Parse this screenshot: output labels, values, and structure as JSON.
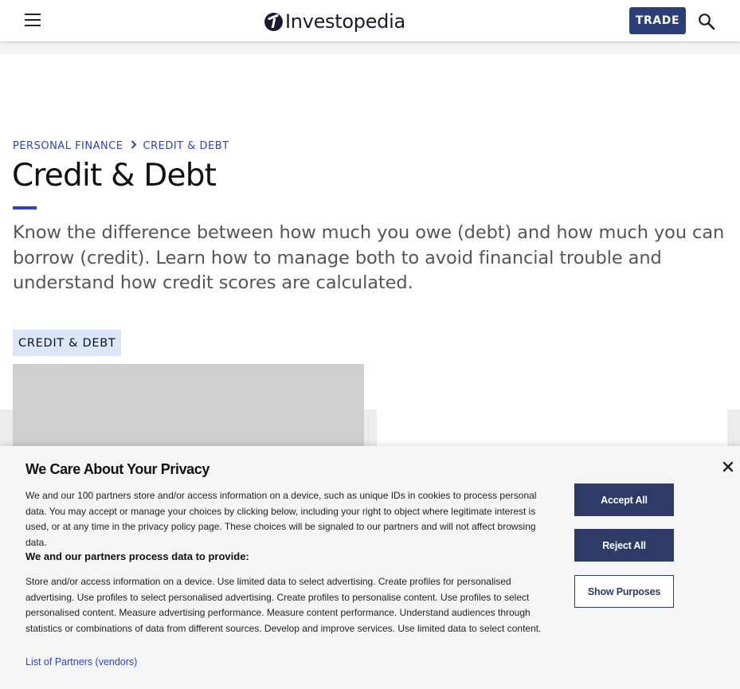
{
  "header": {
    "logo_text": "Investopedia",
    "trade_label": "TRADE",
    "icons": [
      "hamburger-menu-icon",
      "investopedia-logo-icon",
      "search-icon"
    ]
  },
  "breadcrumb": {
    "items": [
      "PERSONAL FINANCE",
      "CREDIT & DEBT"
    ],
    "separator_icon": "chevron-right-icon"
  },
  "page": {
    "title": "Credit & Debt",
    "intro": "Know the difference between how much you owe (debt) and how much you can borrow (credit). Learn how to manage both to avoid financial trouble and understand how credit scores are calculated.",
    "tag_label": "CREDIT & DEBT"
  },
  "privacy": {
    "title": "We Care About Your Privacy",
    "intro": "We and our 100 partners store and/or access information on a device, such as unique IDs in cookies to process personal data. You may accept or manage your choices by clicking below, including your right to object where legitimate interest is used, or at any time in the privacy policy page. These choices will be signaled to our partners and will not affect browsing data.",
    "subhead": "We and our partners process data to provide:",
    "purposes": "Store and/or access information on a device. Use limited data to select advertising. Create profiles for personalised advertising. Use profiles to select personalised advertising. Create profiles to personalise content. Use profiles to select personalised content. Measure advertising performance. Measure content performance. Understand audiences through statistics or combinations of data from different sources. Develop and improve services. Use limited data to select content.",
    "partners_link": "List of Partners (vendors)",
    "accept_label": "Accept All",
    "reject_label": "Reject All",
    "show_purposes_label": "Show Purposes",
    "close_icon": "close-icon"
  },
  "colors": {
    "brand_blue": "#2d43c0",
    "trade_button": "#2c3e78",
    "privacy_button": "#2d3b66",
    "tag_background": "#dce6fb"
  }
}
